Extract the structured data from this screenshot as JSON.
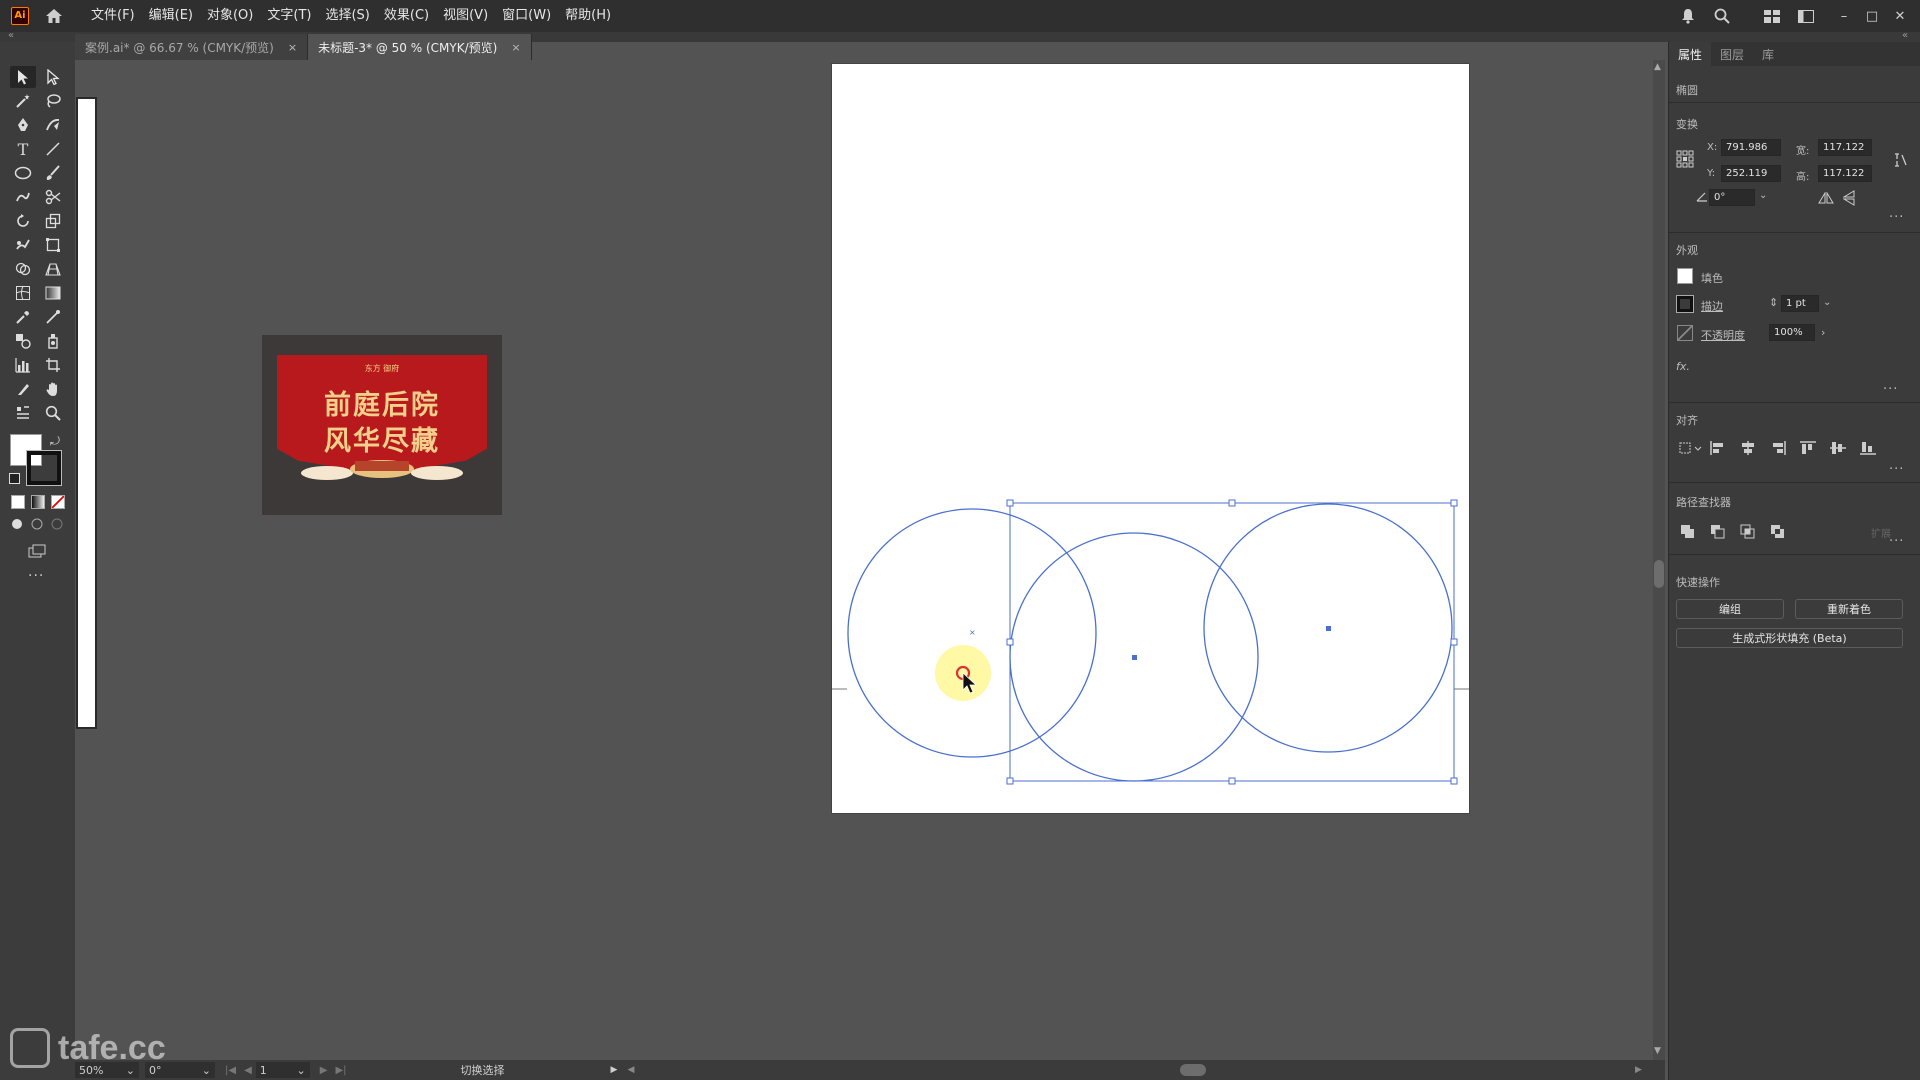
{
  "app": {
    "logo_text": "Ai",
    "menus": [
      "文件(F)",
      "编辑(E)",
      "对象(O)",
      "文字(T)",
      "选择(S)",
      "效果(C)",
      "视图(V)",
      "窗口(W)",
      "帮助(H)"
    ]
  },
  "tabs": [
    {
      "label": "案例.ai* @ 66.67 % (CMYK/预览)",
      "close": "×",
      "active": false
    },
    {
      "label": "未标题-3* @ 50 % (CMYK/预览)",
      "close": "×",
      "active": true
    }
  ],
  "thumbnail": {
    "subtitle": "东方 御府",
    "line1": "前庭后院",
    "line2": "风华尽藏",
    "colors": {
      "background": "#3e3939",
      "banner": "#b8191c",
      "gold": "#f2cf8a"
    }
  },
  "properties": {
    "tabs": [
      "属性",
      "图层",
      "库"
    ],
    "object_type": "椭圆",
    "transform": {
      "title": "变换",
      "x_label": "X:",
      "x": "791.986",
      "y_label": "Y:",
      "y": "252.119",
      "w_label": "宽:",
      "w": "117.122",
      "h_label": "高:",
      "h": "117.122",
      "angle": "0°"
    },
    "appearance": {
      "title": "外观",
      "fill_label": "填色",
      "stroke_label": "描边",
      "stroke_value": "1 pt",
      "opacity_label": "不透明度",
      "opacity_value": "100%",
      "fx_label": "fx."
    },
    "align": {
      "title": "对齐"
    },
    "pathfinder": {
      "title": "路径查找器",
      "expand_label": "扩展"
    },
    "quick_actions": {
      "title": "快速操作",
      "group_button": "编组",
      "recolor_button": "重新着色",
      "generate_button": "生成式形状填充 (Beta)"
    }
  },
  "statusbar": {
    "zoom": "50%",
    "rotation": "0°",
    "artboard_number": "1",
    "status_text": "切换选择"
  },
  "watermark": "tafe.cc",
  "colors": {
    "selection_blue": "#4a6fd0",
    "ui_dark": "#2f2f2f",
    "canvas_gray": "#535353",
    "cursor_highlight": "#fff79a",
    "click_ring": "#e03030"
  }
}
